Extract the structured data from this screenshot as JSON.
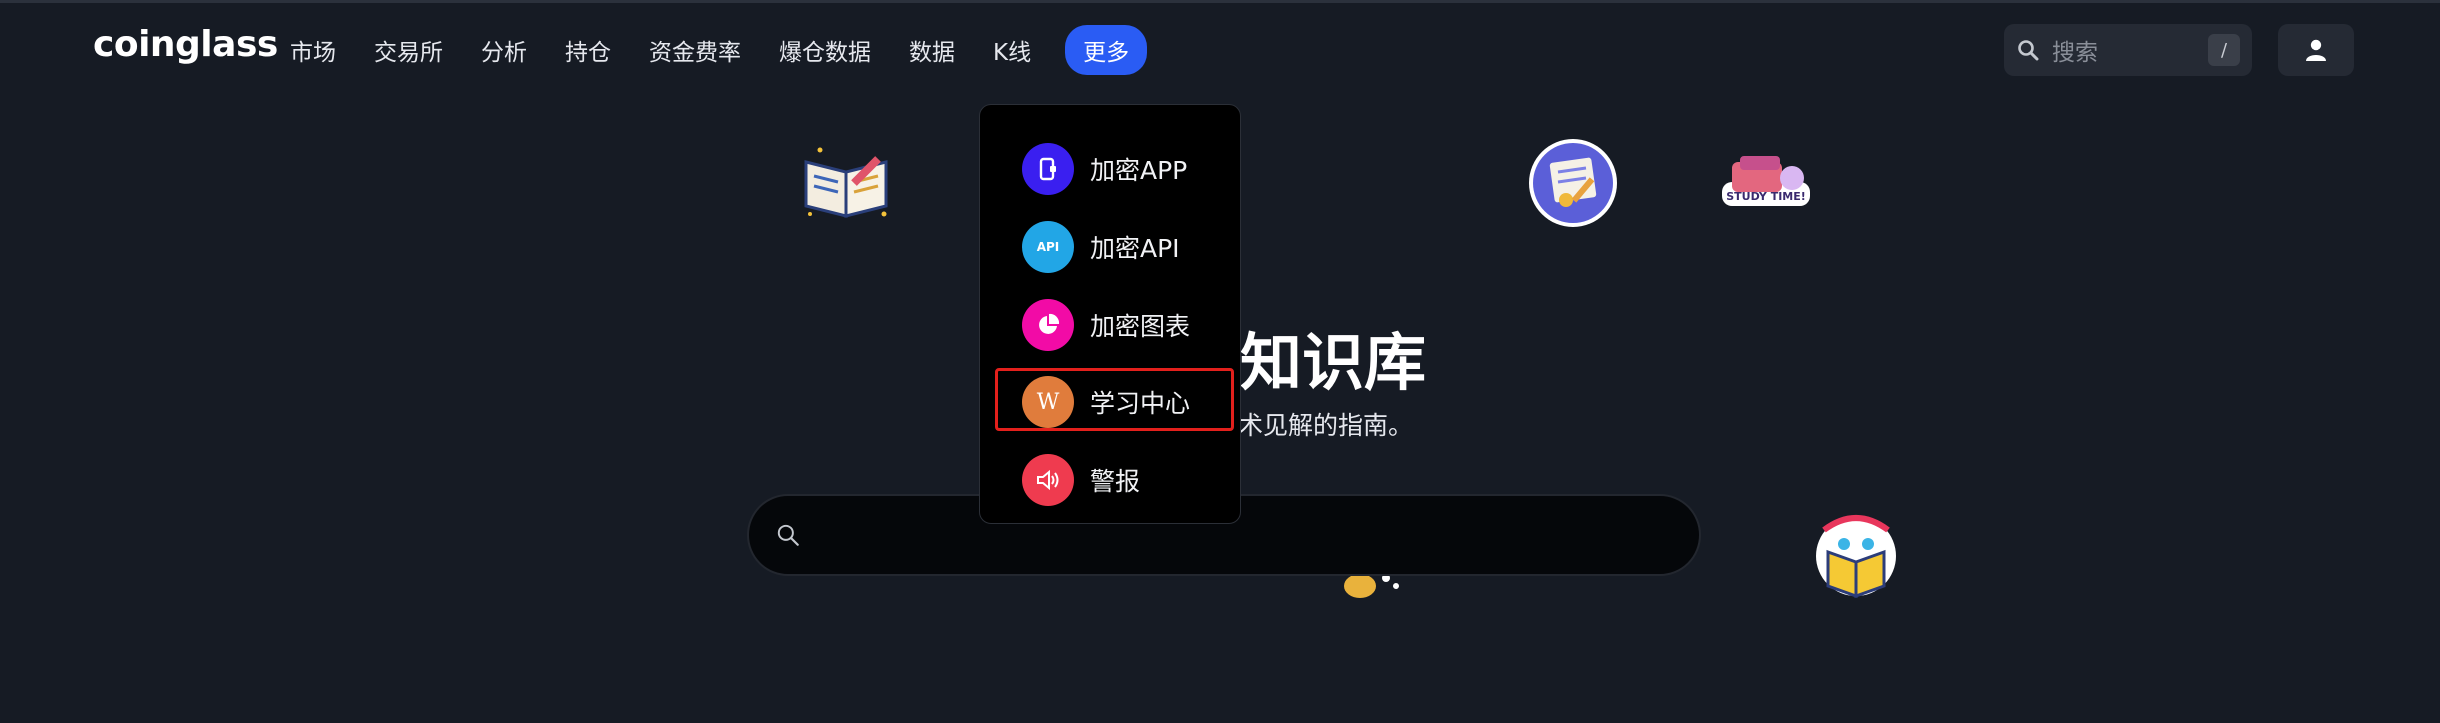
{
  "header": {
    "logo": "coinglass",
    "nav": [
      "市场",
      "交易所",
      "分析",
      "持仓",
      "资金费率",
      "爆仓数据",
      "数据",
      "K线"
    ],
    "nav_active": "更多",
    "search_placeholder": "搜索",
    "search_shortcut": "/"
  },
  "hero": {
    "title_visible": "知识库",
    "subtitle_visible": "术见解的指南。",
    "search_icon": "search-icon"
  },
  "dropdown": {
    "items": [
      {
        "label": "加密APP",
        "icon": "mobile-app-icon",
        "color": "#3a1ff0"
      },
      {
        "label": "加密API",
        "icon": "api-icon",
        "icon_text": "API",
        "color": "#22a6e6"
      },
      {
        "label": "加密图表",
        "icon": "pie-chart-icon",
        "color": "#f20ba6"
      },
      {
        "label": "学习中心",
        "icon": "wiki-icon",
        "icon_text": "W",
        "color": "#e07c3c"
      },
      {
        "label": "警报",
        "icon": "speaker-icon",
        "color": "#ef3b4f"
      }
    ],
    "highlight_color": "#e3201c"
  },
  "colors": {
    "background": "#161b24",
    "accent": "#2a5cf4"
  }
}
